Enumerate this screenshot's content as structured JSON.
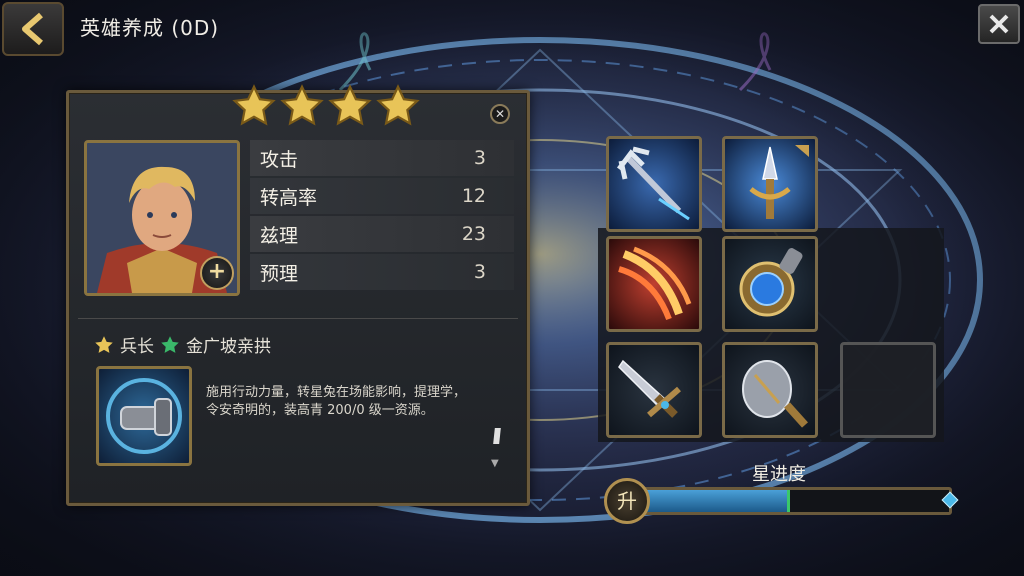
{
  "header": {
    "title": "英雄养成 (0D)",
    "back_icon": "chevron-left-icon",
    "close_icon": "close-icon"
  },
  "hero": {
    "star_count": 4,
    "stats": [
      {
        "label": "攻击",
        "value": "3"
      },
      {
        "label": "转高率",
        "value": "12"
      },
      {
        "label": "兹理",
        "value": "23"
      },
      {
        "label": "预理",
        "value": "3"
      }
    ],
    "skill": {
      "tag1": "兵长",
      "tag2": "金广坡亲拱",
      "description": "施用行动力量，转星兔在场能影响，提理学，令安奇明的，装高青 200/0 级一资源。"
    }
  },
  "equipment": {
    "slots": [
      {
        "icon": "trident-icon"
      },
      {
        "icon": "spear-trophy-icon"
      },
      {
        "icon": "flame-claw-icon"
      },
      {
        "icon": "blue-gem-amulet-icon"
      },
      {
        "icon": "sword-icon"
      },
      {
        "icon": "mace-head-icon"
      },
      {
        "icon": "empty-slot"
      }
    ]
  },
  "progress": {
    "title": "星进度",
    "button_label": "升",
    "fill_fraction": 0.48
  },
  "colors": {
    "frame_gold": "#8a7440",
    "progress_blue": "#4aa0d8",
    "progress_tip": "#3ac86a"
  }
}
